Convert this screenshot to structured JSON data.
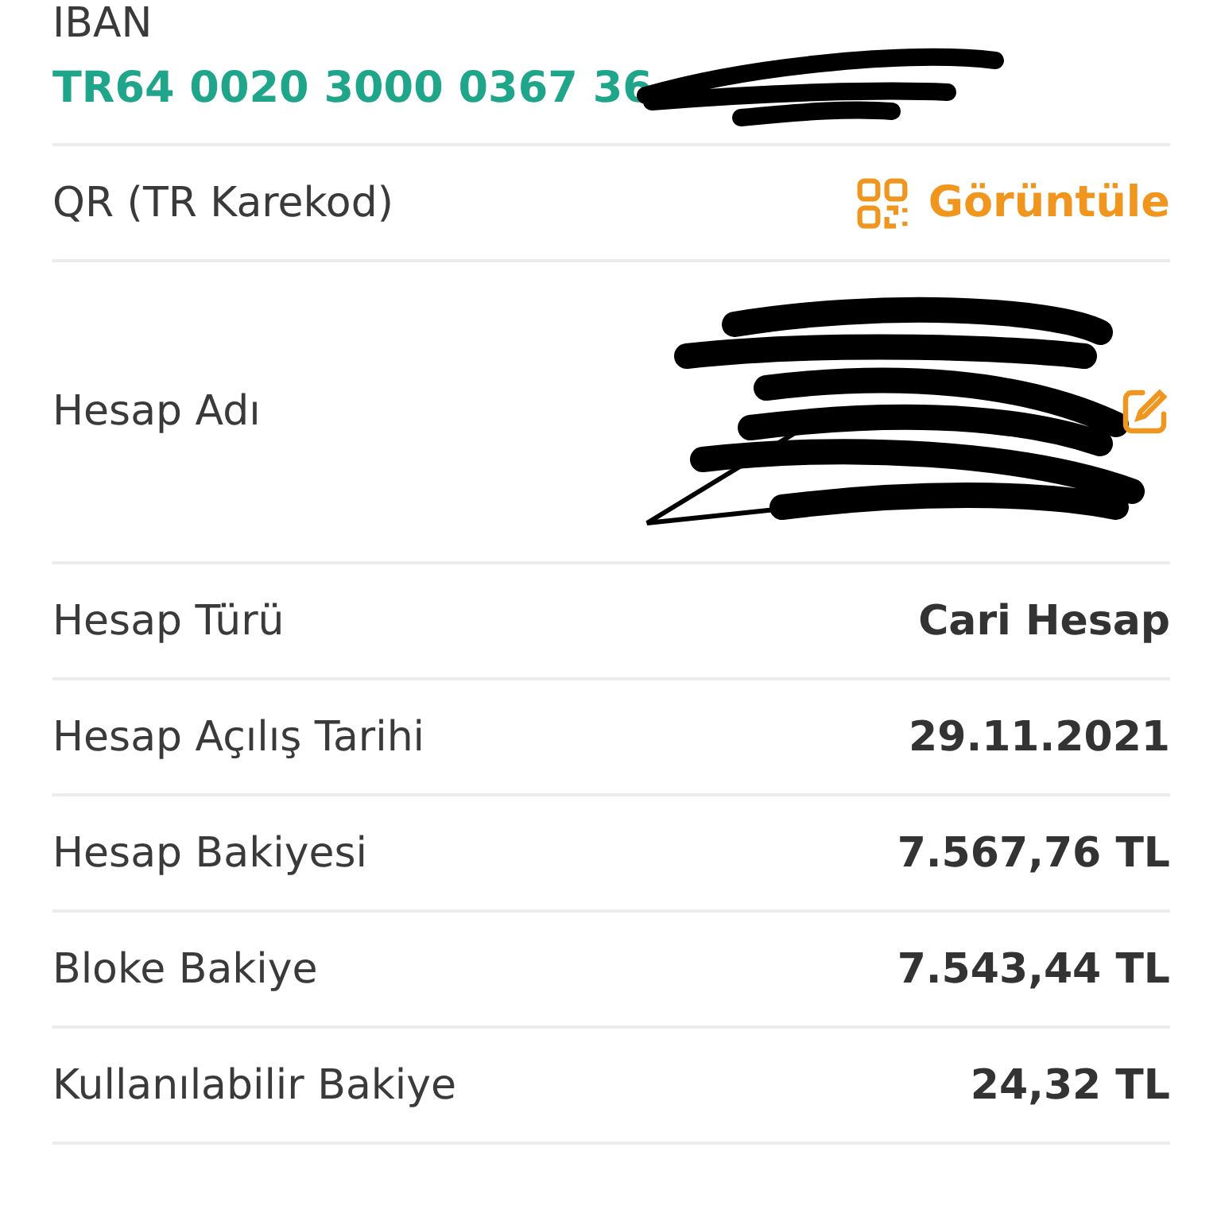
{
  "rows": [
    {
      "kind": "iban",
      "label": "IBAN",
      "value": "TR64 0020 3000 0367 36"
    },
    {
      "kind": "link",
      "label": "QR (TR Karekod)",
      "value": "Görüntüle"
    },
    {
      "kind": "redacted",
      "label": "Hesap Adı"
    },
    {
      "kind": "plain",
      "label": "Hesap Türü",
      "value": "Cari Hesap"
    },
    {
      "kind": "plain",
      "label": "Hesap Açılış Tarihi",
      "value": "29.11.2021"
    },
    {
      "kind": "plain",
      "label": "Hesap Bakiyesi",
      "value": "7.567,76 TL"
    },
    {
      "kind": "plain",
      "label": "Bloke Bakiye",
      "value": "7.543,44 TL"
    },
    {
      "kind": "plain",
      "label": "Kullanılabilir Bakiye",
      "value": "24,32 TL"
    }
  ]
}
